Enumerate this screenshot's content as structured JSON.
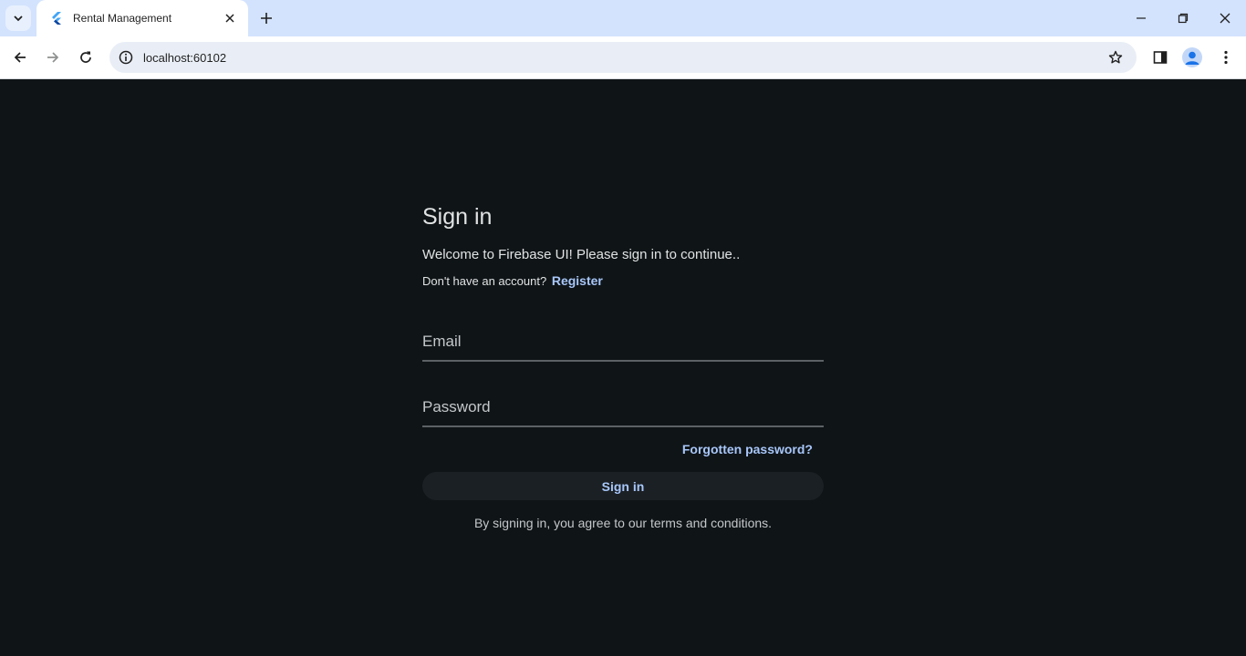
{
  "browser": {
    "tab": {
      "title": "Rental Management"
    },
    "address_bar": {
      "url": "localhost:60102"
    }
  },
  "page": {
    "title": "Sign in",
    "subtitle": "Welcome to Firebase UI! Please sign in to continue..",
    "no_account_text": "Don't have an account?",
    "register_link": "Register",
    "email_placeholder": "Email",
    "password_placeholder": "Password",
    "forgot_password": "Forgotten password?",
    "signin_button": "Sign in",
    "terms_text": "By signing in, you agree to our terms and conditions."
  },
  "colors": {
    "page_background": "#0f1417",
    "accent": "#a8c7fa",
    "tabstrip": "#d3e3fd"
  }
}
